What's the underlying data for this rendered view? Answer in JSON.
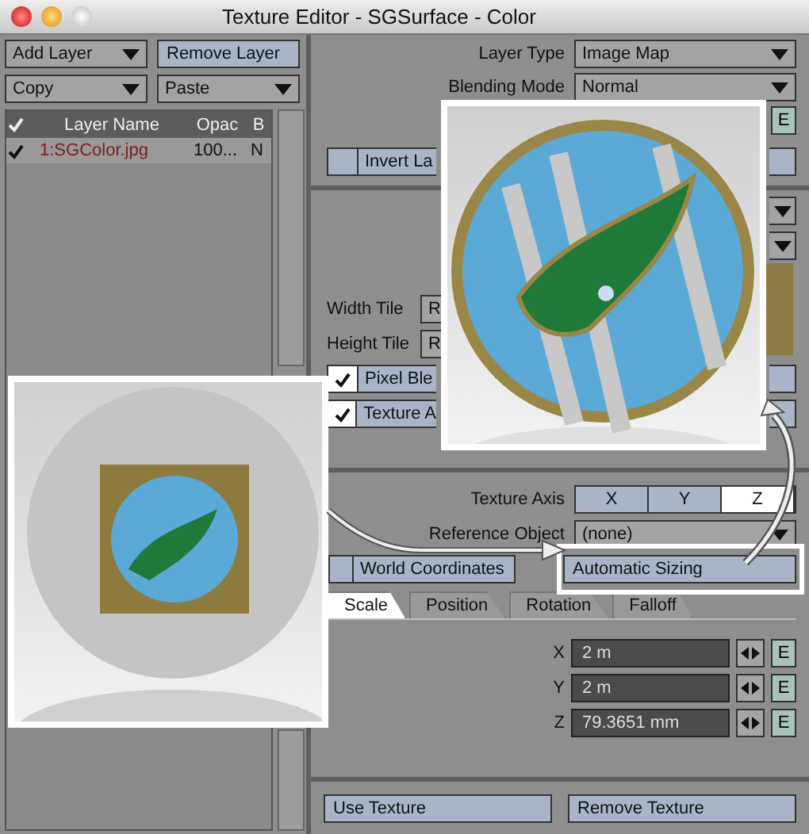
{
  "window": {
    "title": "Texture Editor - SGSurface - Color"
  },
  "layer_panel": {
    "add_layer": "Add Layer",
    "remove_layer": "Remove Layer",
    "copy": "Copy",
    "paste": "Paste",
    "columns": [
      "Layer Name",
      "Opac",
      "B"
    ],
    "rows": [
      {
        "checked": true,
        "name": "1:SGColor.jpg",
        "opacity": "100...",
        "blend": "N"
      }
    ]
  },
  "layer_settings": {
    "layer_type": {
      "label": "Layer Type",
      "value": "Image Map"
    },
    "blending_mode": {
      "label": "Blending Mode",
      "value": "Normal"
    },
    "envelope_button": "E",
    "invert_layer": {
      "label": "Invert La",
      "checked": false
    }
  },
  "image_settings": {
    "width_tile": {
      "label": "Width Tile",
      "value": "R"
    },
    "height_tile": {
      "label": "Height Tile",
      "value": "R"
    },
    "options": [
      {
        "label": "Pixel Ble",
        "checked": true
      },
      {
        "label": "Texture A",
        "checked": true
      }
    ]
  },
  "mapping": {
    "texture_axis": {
      "label": "Texture Axis",
      "options": [
        {
          "label": "X",
          "selected": false
        },
        {
          "label": "Y",
          "selected": false
        },
        {
          "label": "Z",
          "selected": true
        }
      ]
    },
    "reference_object": {
      "label": "Reference Object",
      "value": "(none)"
    },
    "world_coordinates": {
      "label": "World Coordinates",
      "checked": false
    },
    "automatic_sizing": "Automatic Sizing",
    "tabs": [
      {
        "label": "Scale",
        "selected": true
      },
      {
        "label": "Position",
        "selected": false
      },
      {
        "label": "Rotation",
        "selected": false
      },
      {
        "label": "Falloff",
        "selected": false
      }
    ],
    "fields": [
      {
        "axis": "X",
        "value": "2 m",
        "envelope": "E"
      },
      {
        "axis": "Y",
        "value": "2 m",
        "envelope": "E"
      },
      {
        "axis": "Z",
        "value": "79.3651 mm",
        "envelope": "E"
      }
    ]
  },
  "footer": {
    "use_texture": "Use Texture",
    "remove_texture": "Remove Texture"
  }
}
